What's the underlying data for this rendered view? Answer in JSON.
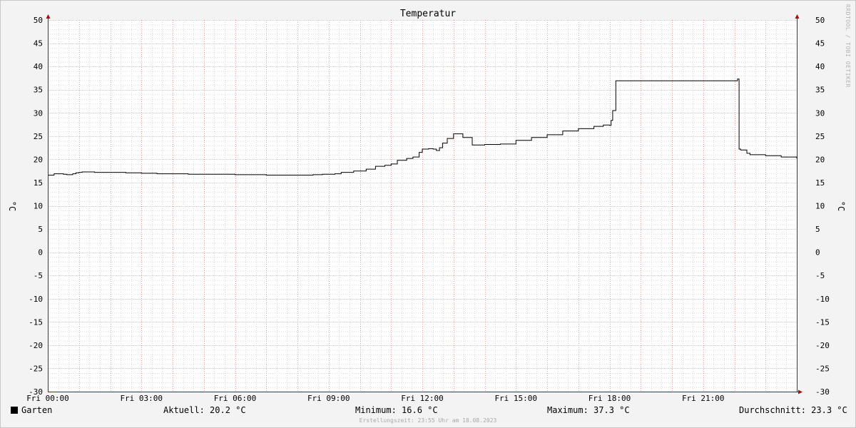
{
  "chart_data": {
    "type": "line",
    "title": "Temperatur",
    "ylabel_left": "°C",
    "ylabel_right": "°C",
    "ylim": [
      -30,
      50
    ],
    "y_ticks": [
      50,
      45,
      40,
      35,
      30,
      25,
      20,
      15,
      10,
      5,
      0,
      -5,
      -10,
      -15,
      -20,
      -25,
      -30
    ],
    "x_tick_labels": [
      "Fri 00:00",
      "Fri 03:00",
      "Fri 06:00",
      "Fri 09:00",
      "Fri 12:00",
      "Fri 15:00",
      "Fri 18:00",
      "Fri 21:00"
    ],
    "x_tick_hours": [
      0,
      3,
      6,
      9,
      12,
      15,
      18,
      21
    ],
    "xlim_hours": [
      0,
      24
    ],
    "grid": true,
    "series": [
      {
        "name": "Garten",
        "color": "#000000",
        "x_hours": [
          0.0,
          0.2,
          0.5,
          0.6,
          0.8,
          0.9,
          1.0,
          1.1,
          1.5,
          2.5,
          3.0,
          3.5,
          3.8,
          4.5,
          5.0,
          5.5,
          6.0,
          6.3,
          7.0,
          7.3,
          7.5,
          8.0,
          8.5,
          8.8,
          9.0,
          9.2,
          9.4,
          9.8,
          10.2,
          10.5,
          10.8,
          11.0,
          11.2,
          11.5,
          11.7,
          11.9,
          12.0,
          12.2,
          12.35,
          12.45,
          12.55,
          12.65,
          12.8,
          13.0,
          13.3,
          13.6,
          14.0,
          14.5,
          15.0,
          15.5,
          16.0,
          16.5,
          17.0,
          17.5,
          17.8,
          18.0,
          18.05,
          18.1,
          18.2,
          19.0,
          20.0,
          21.0,
          22.0,
          22.1,
          22.15,
          22.2,
          22.4,
          22.5,
          23.0,
          23.5,
          24.0
        ],
        "values": [
          16.6,
          16.9,
          16.8,
          16.7,
          16.9,
          17.1,
          17.2,
          17.3,
          17.2,
          17.1,
          17.0,
          16.9,
          16.9,
          16.8,
          16.8,
          16.8,
          16.7,
          16.7,
          16.6,
          16.6,
          16.6,
          16.6,
          16.7,
          16.8,
          16.8,
          16.9,
          17.2,
          17.5,
          17.9,
          18.5,
          18.7,
          19.0,
          19.8,
          20.2,
          20.5,
          21.5,
          22.2,
          22.3,
          22.2,
          21.9,
          22.5,
          23.5,
          24.5,
          25.5,
          24.7,
          23.1,
          23.2,
          23.3,
          24.1,
          24.7,
          25.3,
          26.1,
          26.6,
          27.1,
          27.4,
          27.3,
          28.4,
          30.5,
          36.9,
          36.9,
          36.9,
          36.9,
          36.9,
          37.3,
          22.2,
          22.0,
          21.3,
          21.0,
          20.8,
          20.5,
          20.2
        ]
      }
    ]
  },
  "legend": {
    "series_name": "Garten",
    "current": "Aktuell: 20.2 °C",
    "minimum": "Minimum: 16.6 °C",
    "maximum": "Maximum: 37.3 °C",
    "average": "Durchschnitt: 23.3 °C"
  },
  "footer": "Erstellungszeit: 23:55 Uhr am 18.08.2023",
  "watermark": "RRDTOOL / TOBI OETIKER",
  "colors": {
    "background": "#f3f3f3",
    "plot_background": "#ffffff",
    "minor_grid": "#d9d9d9",
    "major_grid": "#ef9a9a",
    "axis": "#a01010",
    "line": "#000000"
  }
}
